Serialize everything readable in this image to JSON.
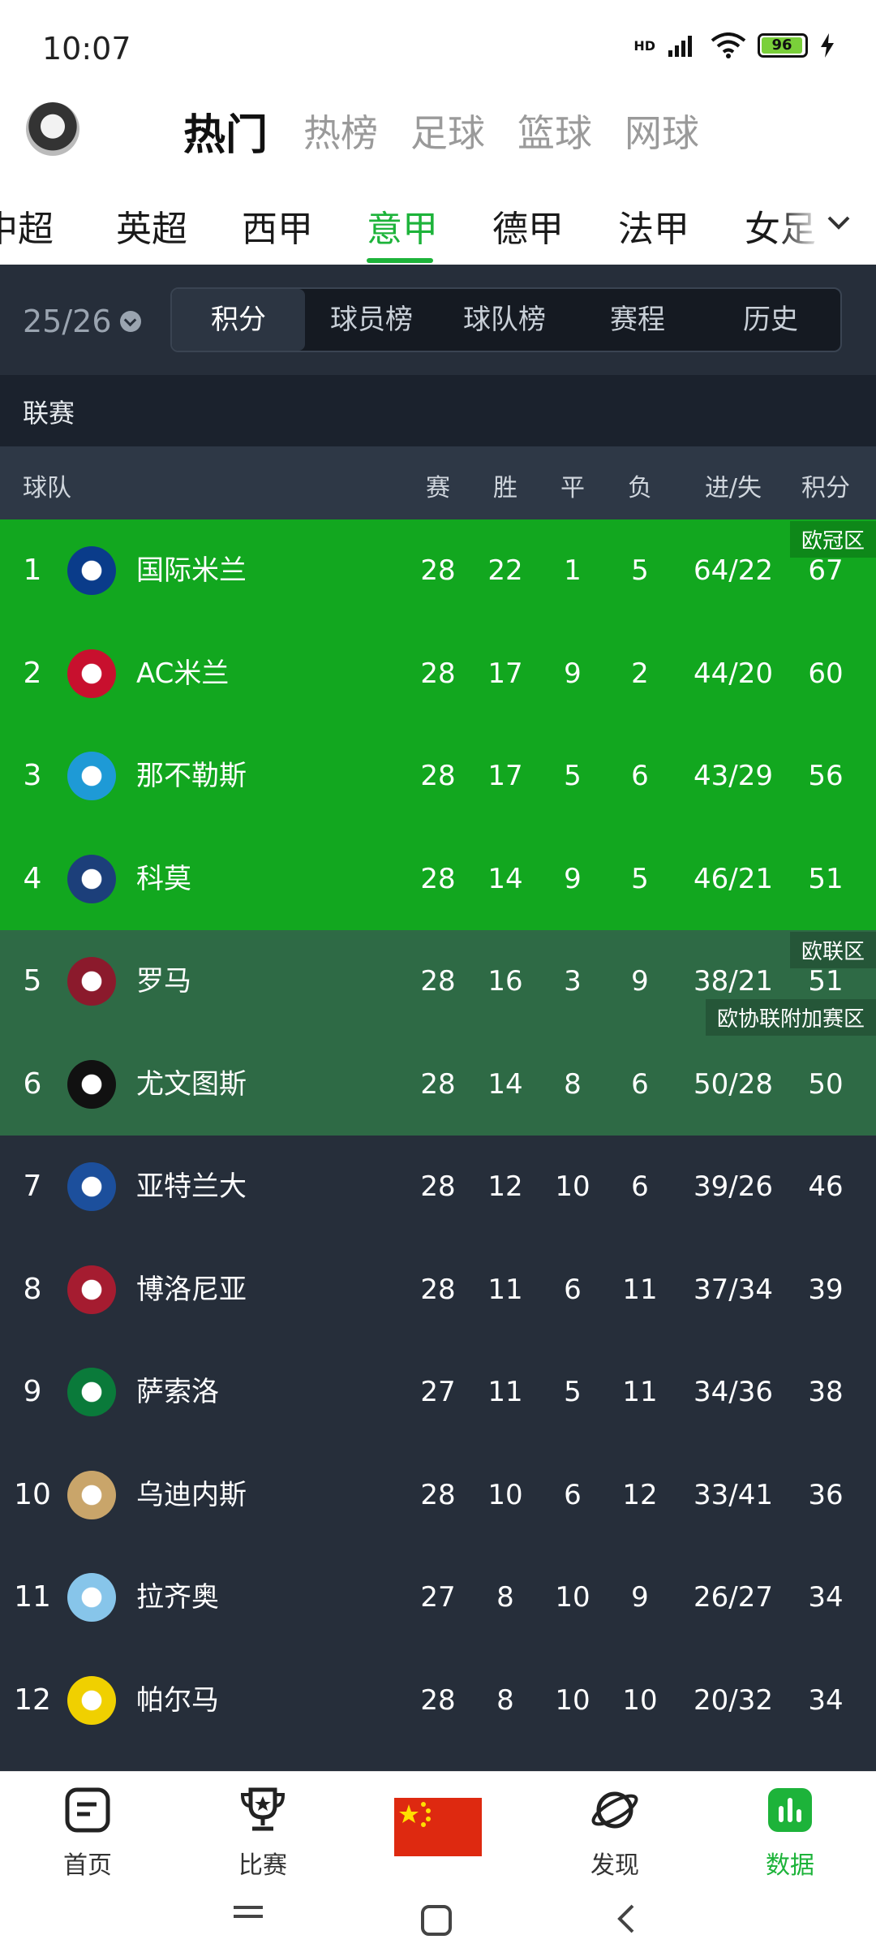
{
  "status": {
    "time": "10:07",
    "battery": "96",
    "network": "HD"
  },
  "top_tabs": [
    {
      "label": "热门",
      "active": true
    },
    {
      "label": "热榜",
      "active": false
    },
    {
      "label": "足球",
      "active": false
    },
    {
      "label": "篮球",
      "active": false
    },
    {
      "label": "网球",
      "active": false
    }
  ],
  "leagues": [
    {
      "label": "中超",
      "active": false
    },
    {
      "label": "英超",
      "active": false
    },
    {
      "label": "西甲",
      "active": false
    },
    {
      "label": "意甲",
      "active": true
    },
    {
      "label": "德甲",
      "active": false
    },
    {
      "label": "法甲",
      "active": false
    },
    {
      "label": "女足",
      "active": false
    }
  ],
  "season": "25/26",
  "segments": [
    {
      "label": "积分",
      "active": true
    },
    {
      "label": "球员榜",
      "active": false
    },
    {
      "label": "球队榜",
      "active": false
    },
    {
      "label": "赛程",
      "active": false
    },
    {
      "label": "历史",
      "active": false
    }
  ],
  "section_label": "联赛",
  "columns": [
    "球队",
    "赛",
    "胜",
    "平",
    "负",
    "进/失",
    "积分"
  ],
  "zones": {
    "ucl": "欧冠区",
    "uel": "欧联区",
    "uecl": "欧协联附加赛区"
  },
  "colors": {
    "ucl": "#12a71f",
    "euro": "#2e6a45",
    "default": "#262e3a",
    "accent": "#1db33a"
  },
  "standings": [
    {
      "rank": "1",
      "team": "国际米兰",
      "p": "28",
      "w": "22",
      "d": "1",
      "l": "5",
      "gd": "64/22",
      "pts": "67",
      "logo": "inter-logo",
      "logo_color": "#0a3c8a"
    },
    {
      "rank": "2",
      "team": "AC米兰",
      "p": "28",
      "w": "17",
      "d": "9",
      "l": "2",
      "gd": "44/20",
      "pts": "60",
      "logo": "acmilan-logo",
      "logo_color": "#c8102e"
    },
    {
      "rank": "3",
      "team": "那不勒斯",
      "p": "28",
      "w": "17",
      "d": "5",
      "l": "6",
      "gd": "43/29",
      "pts": "56",
      "logo": "napoli-logo",
      "logo_color": "#1e9ad6"
    },
    {
      "rank": "4",
      "team": "科莫",
      "p": "28",
      "w": "14",
      "d": "9",
      "l": "5",
      "gd": "46/21",
      "pts": "51",
      "logo": "como-logo",
      "logo_color": "#1c3f7a"
    },
    {
      "rank": "5",
      "team": "罗马",
      "p": "28",
      "w": "16",
      "d": "3",
      "l": "9",
      "gd": "38/21",
      "pts": "51",
      "logo": "roma-logo",
      "logo_color": "#8b1a2c"
    },
    {
      "rank": "6",
      "team": "尤文图斯",
      "p": "28",
      "w": "14",
      "d": "8",
      "l": "6",
      "gd": "50/28",
      "pts": "50",
      "logo": "juventus-logo",
      "logo_color": "#111111"
    },
    {
      "rank": "7",
      "team": "亚特兰大",
      "p": "28",
      "w": "12",
      "d": "10",
      "l": "6",
      "gd": "39/26",
      "pts": "46",
      "logo": "atalanta-logo",
      "logo_color": "#1c4f9c"
    },
    {
      "rank": "8",
      "team": "博洛尼亚",
      "p": "28",
      "w": "11",
      "d": "6",
      "l": "11",
      "gd": "37/34",
      "pts": "39",
      "logo": "bologna-logo",
      "logo_color": "#a51c30"
    },
    {
      "rank": "9",
      "team": "萨索洛",
      "p": "27",
      "w": "11",
      "d": "5",
      "l": "11",
      "gd": "34/36",
      "pts": "38",
      "logo": "sassuolo-logo",
      "logo_color": "#0a7a3a"
    },
    {
      "rank": "10",
      "team": "乌迪内斯",
      "p": "28",
      "w": "10",
      "d": "6",
      "l": "12",
      "gd": "33/41",
      "pts": "36",
      "logo": "udinese-logo",
      "logo_color": "#c9a56a"
    },
    {
      "rank": "11",
      "team": "拉齐奥",
      "p": "27",
      "w": "8",
      "d": "10",
      "l": "9",
      "gd": "26/27",
      "pts": "34",
      "logo": "lazio-logo",
      "logo_color": "#87c5ea"
    },
    {
      "rank": "12",
      "team": "帕尔马",
      "p": "28",
      "w": "8",
      "d": "10",
      "l": "10",
      "gd": "20/32",
      "pts": "34",
      "logo": "parma-logo",
      "logo_color": "#f0d000"
    }
  ],
  "bottom_nav": [
    {
      "label": "首页",
      "icon": "home-icon",
      "active": false
    },
    {
      "label": "比赛",
      "icon": "trophy-icon",
      "active": false
    },
    {
      "label": "",
      "icon": "china-flag",
      "active": false
    },
    {
      "label": "发现",
      "icon": "planet-icon",
      "active": false
    },
    {
      "label": "数据",
      "icon": "chart-icon",
      "active": true
    }
  ]
}
